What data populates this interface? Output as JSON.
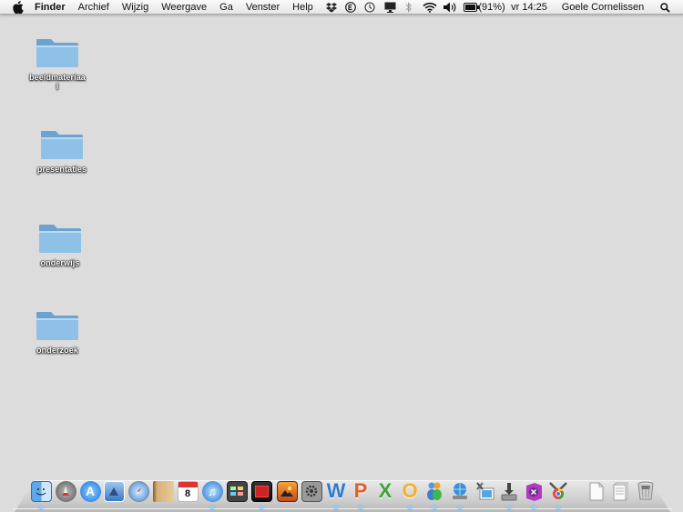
{
  "menubar": {
    "app_name": "Finder",
    "menus": [
      "Archief",
      "Wijzig",
      "Weergave",
      "Ga",
      "Venster",
      "Help"
    ],
    "battery_percent": "(91%)",
    "clock": "vr 14:25",
    "user": "Goele Cornelissen"
  },
  "desktop": {
    "items": [
      {
        "label": "beeldmateriaa\nl"
      },
      {
        "label": "presentaties"
      },
      {
        "label": "onderwijs"
      },
      {
        "label": "onderzoek"
      }
    ]
  },
  "dock": {
    "apps": [
      "finder-icon",
      "launchpad-icon",
      "app-store-icon",
      "preview-icon",
      "safari-icon",
      "contacts-icon",
      "calendar-icon",
      "itunes-icon",
      "photo-booth-icon",
      "flashcards-icon",
      "iphoto-icon",
      "system-preferences-icon",
      "word-icon",
      "powerpoint-icon",
      "excel-icon",
      "outlook-icon",
      "messenger-icon",
      "network-icon",
      "preview-photos-icon",
      "installer-icon",
      "onenote-icon",
      "chrome-icon",
      "document-icon",
      "document-stack-icon",
      "trash-icon"
    ]
  },
  "colors": {
    "desktop_bg": "#dcdcdc",
    "folder_blue": "#7fb3d9",
    "dock_indicator": "#8fd0ff"
  }
}
